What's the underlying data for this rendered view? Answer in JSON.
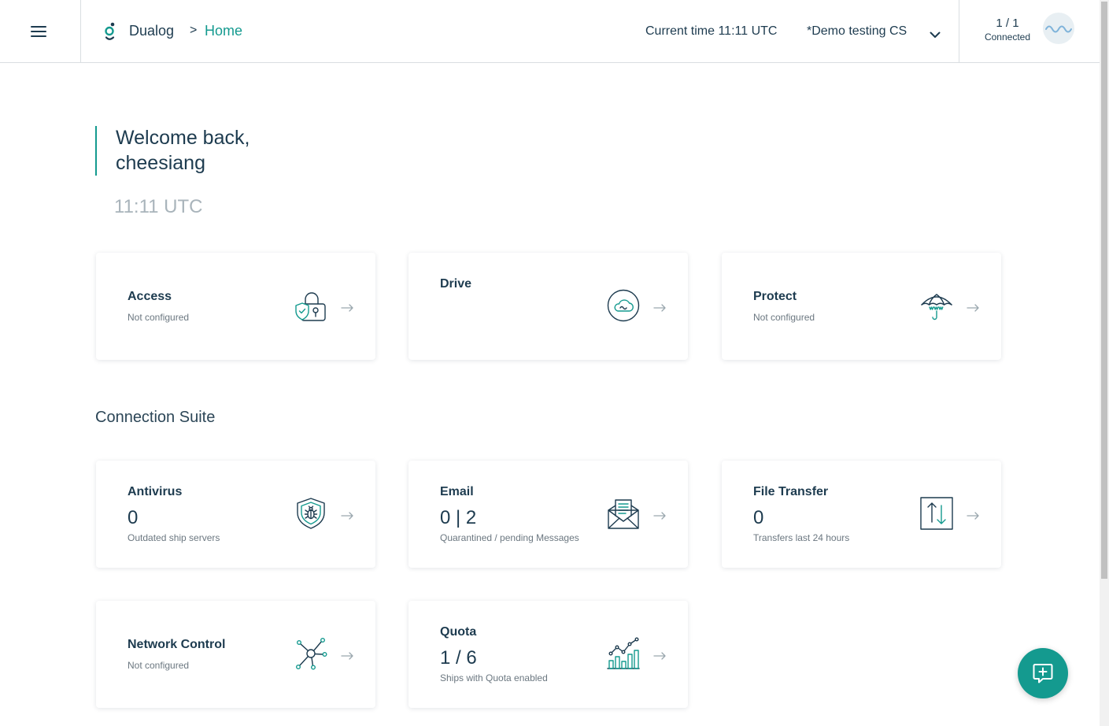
{
  "header": {
    "menu_icon": "hamburger-menu-icon",
    "logo_icon": "dualog-logo-icon",
    "brand": "Dualog",
    "breadcrumb_separator": ">",
    "current_page": "Home",
    "current_time_label": "Current time 11:11 UTC",
    "vessel_selector": "*Demo testing CS",
    "vessel_selector_icon": "chevron-down-icon",
    "connection_count": "1 / 1",
    "connection_status": "Connected",
    "status_icon": "wave-icon"
  },
  "welcome": {
    "line1": "Welcome back,",
    "line2": "cheesiang",
    "time": "11:11 UTC"
  },
  "top_cards": [
    {
      "title": "Access",
      "subtitle": "Not configured",
      "icon": "padlock-shield-icon"
    },
    {
      "title": "Drive",
      "icon": "cloud-circle-icon"
    },
    {
      "title": "Protect",
      "subtitle": "Not configured",
      "icon": "umbrella-icon"
    }
  ],
  "section_title": "Connection Suite",
  "suite_cards": [
    {
      "title": "Antivirus",
      "value": "0",
      "subtitle": "Outdated ship servers",
      "icon": "bug-shield-icon"
    },
    {
      "title": "Email",
      "value": "0 | 2",
      "subtitle": "Quarantined / pending Messages",
      "icon": "envelope-document-icon"
    },
    {
      "title": "File Transfer",
      "value": "0",
      "subtitle": "Transfers last 24 hours",
      "icon": "file-transfer-icon"
    },
    {
      "title": "Network Control",
      "subtitle": "Not configured",
      "icon": "network-nodes-icon"
    },
    {
      "title": "Quota",
      "value": "1 / 6",
      "subtitle": "Ships with Quota enabled",
      "icon": "bar-chart-icon"
    }
  ],
  "card_arrow_icon": "arrow-right-icon",
  "fab": {
    "icon": "add-message-icon"
  },
  "colors": {
    "accent": "#149a8f",
    "text_primary": "#1d3b4f",
    "text_muted": "#6b7780",
    "time_muted": "#a9b4bb"
  }
}
